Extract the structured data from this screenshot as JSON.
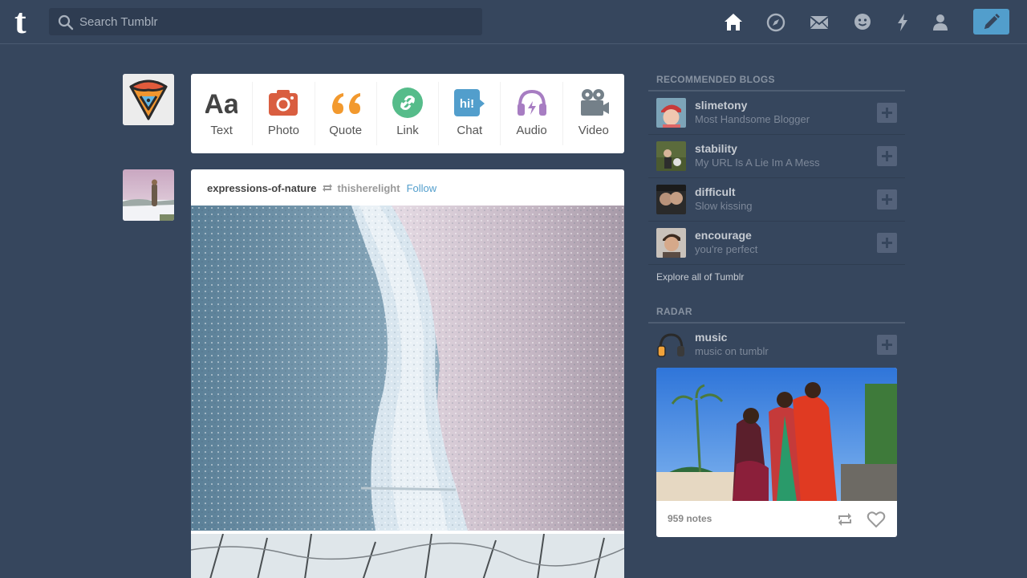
{
  "header": {
    "search_placeholder": "Search Tumblr",
    "nav_icons": [
      "home-icon",
      "explore-icon",
      "inbox-icon",
      "messaging-icon",
      "activity-icon",
      "account-icon"
    ],
    "compose_icon": "pencil-icon",
    "logo_letter": "t"
  },
  "post_types": [
    {
      "label": "Text",
      "icon": "text-icon",
      "color": "#444444"
    },
    {
      "label": "Photo",
      "icon": "camera-icon",
      "color": "#d95e40"
    },
    {
      "label": "Quote",
      "icon": "quote-icon",
      "color": "#f2992e"
    },
    {
      "label": "Link",
      "icon": "link-icon",
      "color": "#56bc8a"
    },
    {
      "label": "Chat",
      "icon": "chat-icon",
      "color": "#529ecc"
    },
    {
      "label": "Audio",
      "icon": "headphones-icon",
      "color": "#a77dc2"
    },
    {
      "label": "Video",
      "icon": "video-camera-icon",
      "color": "#748089"
    }
  ],
  "post": {
    "blog_name": "expressions-of-nature",
    "reblogged_from": "thisherelight",
    "follow_label": "Follow"
  },
  "sidebar": {
    "recommended_title": "RECOMMENDED BLOGS",
    "recommended": [
      {
        "name": "slimetony",
        "description": "Most Handsome Blogger"
      },
      {
        "name": "stability",
        "description": "My URL Is A Lie Im A Mess"
      },
      {
        "name": "difficult",
        "description": "Slow kissing"
      },
      {
        "name": "encourage",
        "description": "you're perfect"
      }
    ],
    "explore_label": "Explore all of Tumblr",
    "radar_title": "RADAR",
    "radar": {
      "name": "music",
      "description": "music on tumblr",
      "notes": "959 notes"
    }
  },
  "colors": {
    "background": "#36465d",
    "accent": "#529ecc"
  }
}
